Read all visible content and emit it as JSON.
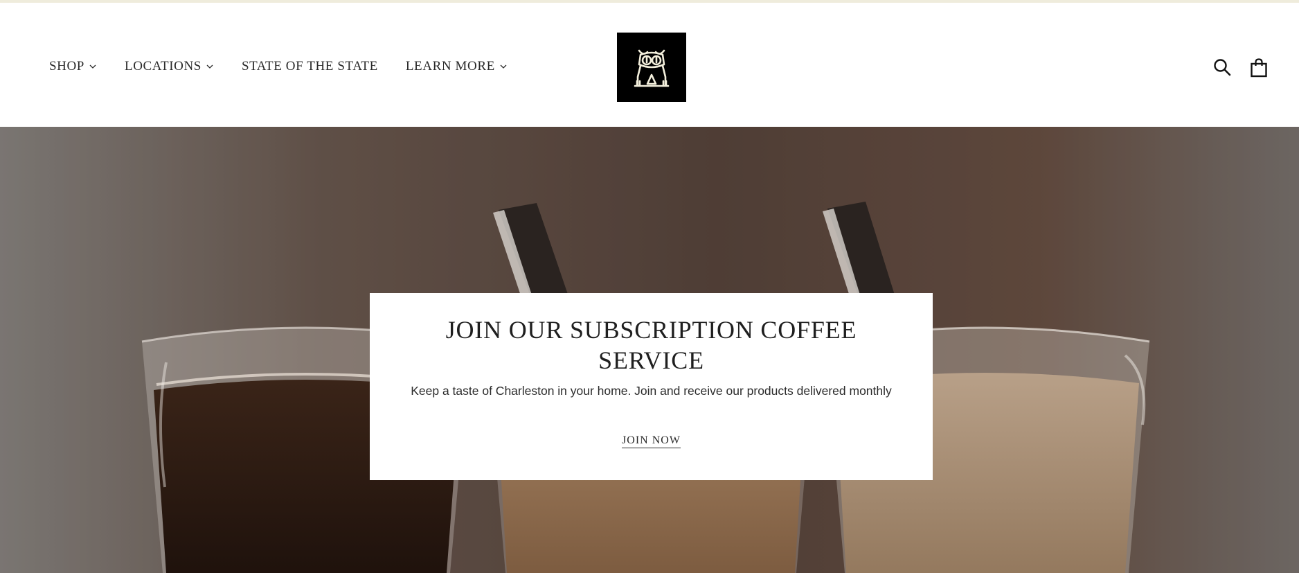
{
  "header": {
    "nav": [
      {
        "label": "SHOP",
        "has_dropdown": true
      },
      {
        "label": "LOCATIONS",
        "has_dropdown": true
      },
      {
        "label": "STATE OF THE STATE",
        "has_dropdown": false
      },
      {
        "label": "LEARN MORE",
        "has_dropdown": true
      }
    ],
    "logo_icon": "owl-logo-icon",
    "icons": [
      "search-icon",
      "shopping-bag-icon"
    ]
  },
  "hero": {
    "background": "coffee-cups-photo",
    "promo": {
      "title": "JOIN OUR SUBSCRIPTION COFFEE SERVICE",
      "text": "Keep a taste of Charleston in your home. Join and receive our products delivered monthly",
      "link_label": "JOIN NOW"
    }
  },
  "colors": {
    "top_strip": "#efecdc",
    "logo_bg": "#000000",
    "logo_fg": "#f3efdc",
    "text": "#222222"
  }
}
